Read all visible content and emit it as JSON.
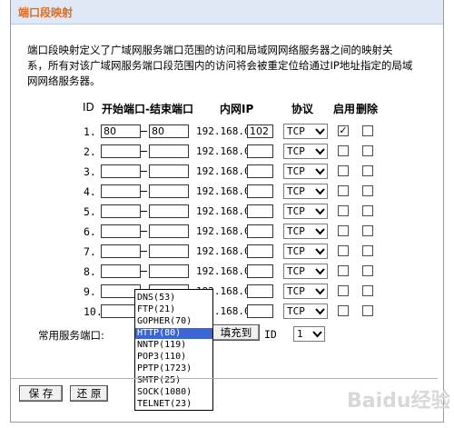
{
  "title": "端口段映射",
  "description": "端口段映射定义了广域网服务端口范围的访问和局域网网络服务器之间的映射关系，所有对该广域网服务端口段范围内的访问将会被重定位给通过IP地址指定的局域网网络服务器。",
  "headers": {
    "id": "ID",
    "range": "开始端口-结束端口",
    "ip": "内网IP",
    "protocol": "协议",
    "enable": "启用",
    "delete": "删除"
  },
  "ip_prefix": "192.168.0.",
  "rows": [
    {
      "id": "1.",
      "start": "80",
      "end": "80",
      "ip": "102",
      "protocol": "TCP",
      "enabled": true,
      "delete": false
    },
    {
      "id": "2.",
      "start": "",
      "end": "",
      "ip": "",
      "protocol": "TCP",
      "enabled": false,
      "delete": false
    },
    {
      "id": "3.",
      "start": "",
      "end": "",
      "ip": "",
      "protocol": "TCP",
      "enabled": false,
      "delete": false
    },
    {
      "id": "4.",
      "start": "",
      "end": "",
      "ip": "",
      "protocol": "TCP",
      "enabled": false,
      "delete": false
    },
    {
      "id": "5.",
      "start": "",
      "end": "",
      "ip": "",
      "protocol": "TCP",
      "enabled": false,
      "delete": false
    },
    {
      "id": "6.",
      "start": "",
      "end": "",
      "ip": "",
      "protocol": "TCP",
      "enabled": false,
      "delete": false
    },
    {
      "id": "7.",
      "start": "",
      "end": "",
      "ip": "",
      "protocol": "TCP",
      "enabled": false,
      "delete": false
    },
    {
      "id": "8.",
      "start": "",
      "end": "",
      "ip": "",
      "protocol": "TCP",
      "enabled": false,
      "delete": false
    },
    {
      "id": "9.",
      "start": "",
      "end": "",
      "ip": "",
      "protocol": "TCP",
      "enabled": false,
      "delete": false
    },
    {
      "id": "10.",
      "start": "",
      "end": "",
      "ip": "",
      "protocol": "TCP",
      "enabled": false,
      "delete": false
    }
  ],
  "common_services": {
    "label": "常用服务端口:",
    "fill_button": "填充到",
    "id_label": "ID",
    "id_value": "1",
    "options": [
      "DNS(53)",
      "FTP(21)",
      "GOPHER(70)",
      "HTTP(80)",
      "NNTP(119)",
      "POP3(110)",
      "PPTP(1723)",
      "SMTP(25)",
      "SOCK(1080)",
      "TELNET(23)"
    ],
    "highlighted": "HTTP(80)"
  },
  "buttons": {
    "save": "保 存",
    "restore": "还 原"
  },
  "watermark": "Baidu经验"
}
